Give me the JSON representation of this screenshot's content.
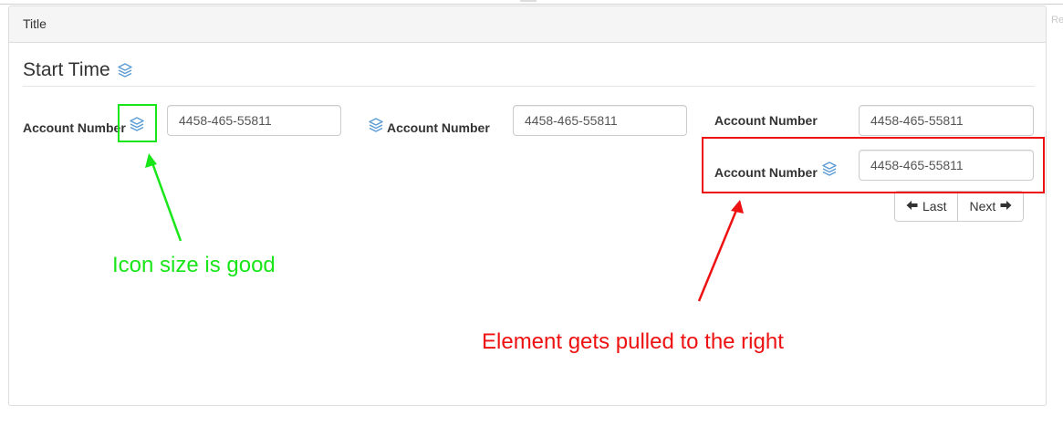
{
  "edge_text": "Re",
  "panel": {
    "title": "Title",
    "section_title": "Start Time"
  },
  "fields": [
    {
      "label": "Account Number",
      "value": "4458-465-55811"
    },
    {
      "label": "Account Number",
      "value": "4458-465-55811"
    },
    {
      "label": "Account Number",
      "value": "4458-465-55811"
    },
    {
      "label": "Account Number",
      "value": "4458-465-55811"
    }
  ],
  "pager": {
    "last_label": "Last",
    "next_label": "Next"
  },
  "annotations": {
    "green_note": "Icon size is good",
    "red_note": "Element gets pulled to the right",
    "green_color": "#19e619",
    "red_color": "#ee1111"
  },
  "icons": {
    "info": "stack-layers-icon",
    "prev": "arrow-left-icon",
    "next": "arrow-right-icon"
  },
  "colors": {
    "icon": "#5b9bd5",
    "panel_heading_bg": "#f5f5f5",
    "border": "#dddddd"
  }
}
